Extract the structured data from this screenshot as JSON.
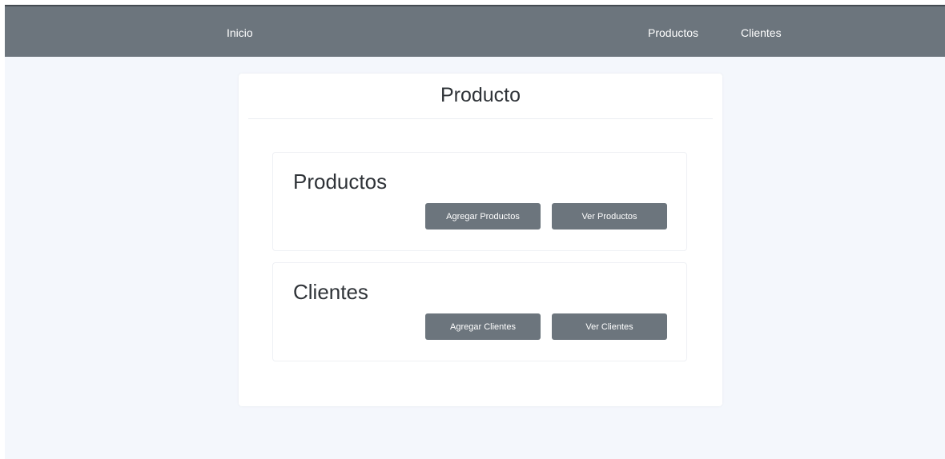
{
  "navbar": {
    "home_label": "Inicio",
    "links": [
      {
        "label": "Productos"
      },
      {
        "label": "Clientes"
      }
    ]
  },
  "card": {
    "title": "Producto",
    "sections": [
      {
        "title": "Productos",
        "add_button": "Agregar Productos",
        "view_button": "Ver Productos"
      },
      {
        "title": "Clientes",
        "add_button": "Agregar Clientes",
        "view_button": "Ver Clientes"
      }
    ]
  },
  "colors": {
    "navbar_bg": "#6c757d",
    "page_bg": "#f4f7fc",
    "button_bg": "#6c757d",
    "text_dark": "#2f3338"
  }
}
